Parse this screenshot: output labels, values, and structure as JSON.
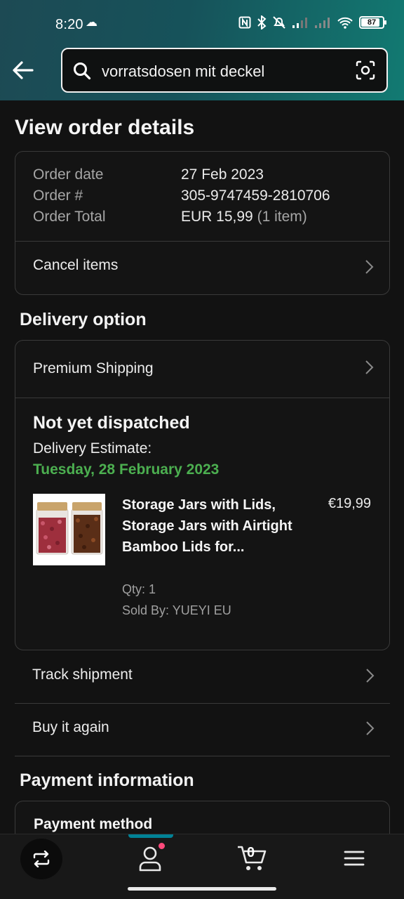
{
  "status_bar": {
    "time": "8:20",
    "weather_icon": "cloud-icon",
    "battery": "87"
  },
  "search": {
    "query": "vorratsdosen mit deckel"
  },
  "page": {
    "title": "View order details"
  },
  "order_summary": {
    "date_label": "Order date",
    "date_value": "27 Feb 2023",
    "number_label": "Order #",
    "number_value": "305-9747459-2810706",
    "total_label": "Order Total",
    "total_value": "EUR 15,99",
    "total_items": "(1 item)"
  },
  "cancel_items": "Cancel items",
  "delivery": {
    "section_title": "Delivery option",
    "shipping_option": "Premium Shipping",
    "status": "Not yet dispatched",
    "estimate_label": "Delivery Estimate:",
    "estimate_date": "Tuesday, 28 February 2023",
    "estimate_color": "#4caf50",
    "item": {
      "title": "Storage Jars with Lids, Storage Jars with Airtight Bamboo Lids for...",
      "price": "€19,99",
      "qty": "Qty: 1",
      "seller": "Sold By: YUEYI EU"
    }
  },
  "actions": {
    "track": "Track shipment",
    "buy_again": "Buy it again"
  },
  "payment": {
    "section_title": "Payment information",
    "method_label": "Payment method"
  },
  "bottom_nav": {
    "cart_count": "0",
    "accent": "#008296",
    "notification_color": "#ff4a7c"
  }
}
